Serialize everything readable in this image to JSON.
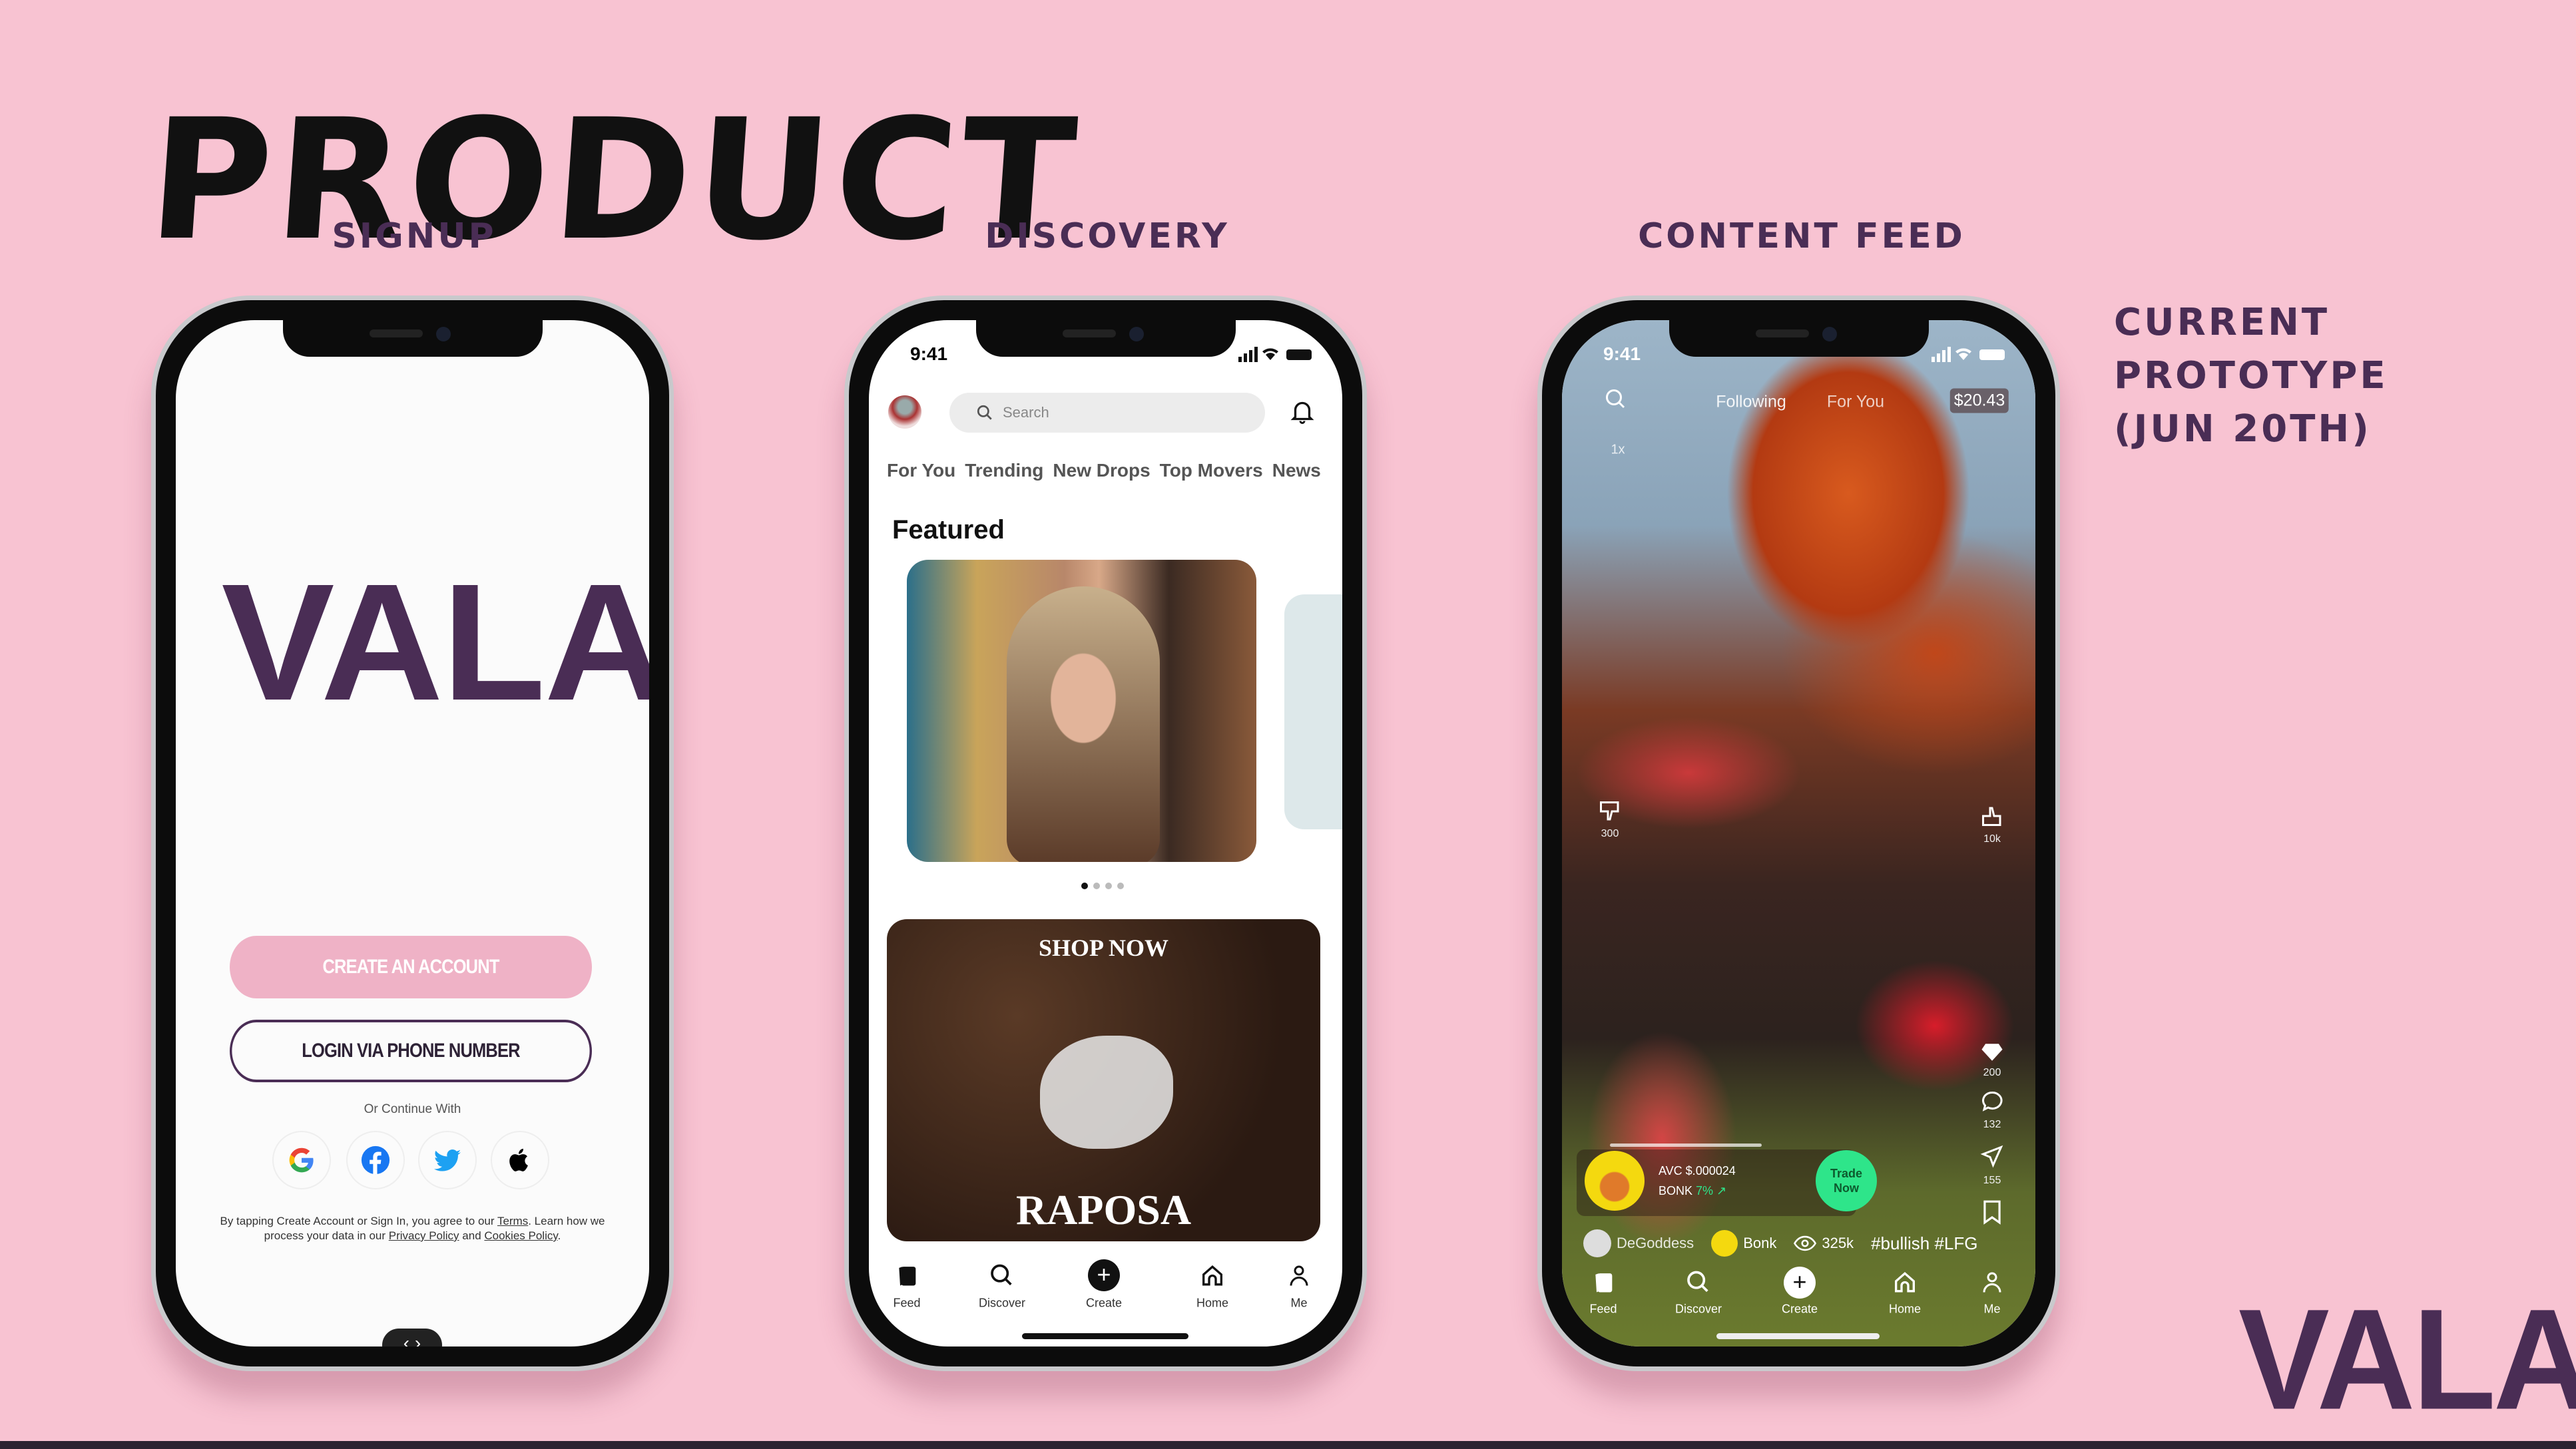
{
  "title": "PRODUCT",
  "labels": {
    "signup": "SIGNUP",
    "discovery": "DISCOVERY",
    "content_feed": "CONTENT FEED"
  },
  "note": [
    "CURRENT",
    "PROTOTYPE",
    "(JUN 20TH)"
  ],
  "logo": "VALA",
  "signup": {
    "brand": "VALA",
    "create_label": "CREATE AN ACCOUNT",
    "login_label": "LOGIN VIA PHONE NUMBER",
    "continue_text": "Or Continue With",
    "social": [
      "google-icon",
      "facebook-icon",
      "twitter-icon",
      "apple-icon"
    ],
    "legal_1": "By tapping Create Account or Sign In, you agree to our ",
    "terms": "Terms",
    "legal_2": ". Learn how we process your data in our ",
    "privacy": "Privacy Policy",
    "legal_3": " and ",
    "cookies": "Cookies Policy",
    "legal_4": ".",
    "pager": "‹ ›"
  },
  "discovery": {
    "time": "9:41",
    "search_placeholder": "Search",
    "tabs": [
      "For You",
      "Trending",
      "New Drops",
      "Top Movers",
      "News"
    ],
    "section": "Featured",
    "promo_title": "SHOP NOW",
    "promo_brand": "RAPOSA",
    "nav": [
      "Feed",
      "Discover",
      "Create",
      "Home",
      "Me"
    ]
  },
  "feed": {
    "time": "9:41",
    "tab_following": "Following",
    "tab_for_you": "For You",
    "balance": "$20.43",
    "speed": "1x",
    "dislikes": "300",
    "likes": "10k",
    "gems": "200",
    "comments": "132",
    "shares": "155",
    "token_price": "AVC $.000024",
    "token_name": "BONK",
    "token_change": "7%",
    "trade_label": "Trade Now",
    "creator": "DeGoddess",
    "coin": "Bonk",
    "views": "325k",
    "hashtags": "#bullish #LFG",
    "nav": [
      "Feed",
      "Discover",
      "Create",
      "Home",
      "Me"
    ]
  },
  "colors": {
    "background": "#f8c3d2",
    "brand": "#4a2d55",
    "create_button": "#efb2c6",
    "trade_button": "#2ee58a"
  }
}
